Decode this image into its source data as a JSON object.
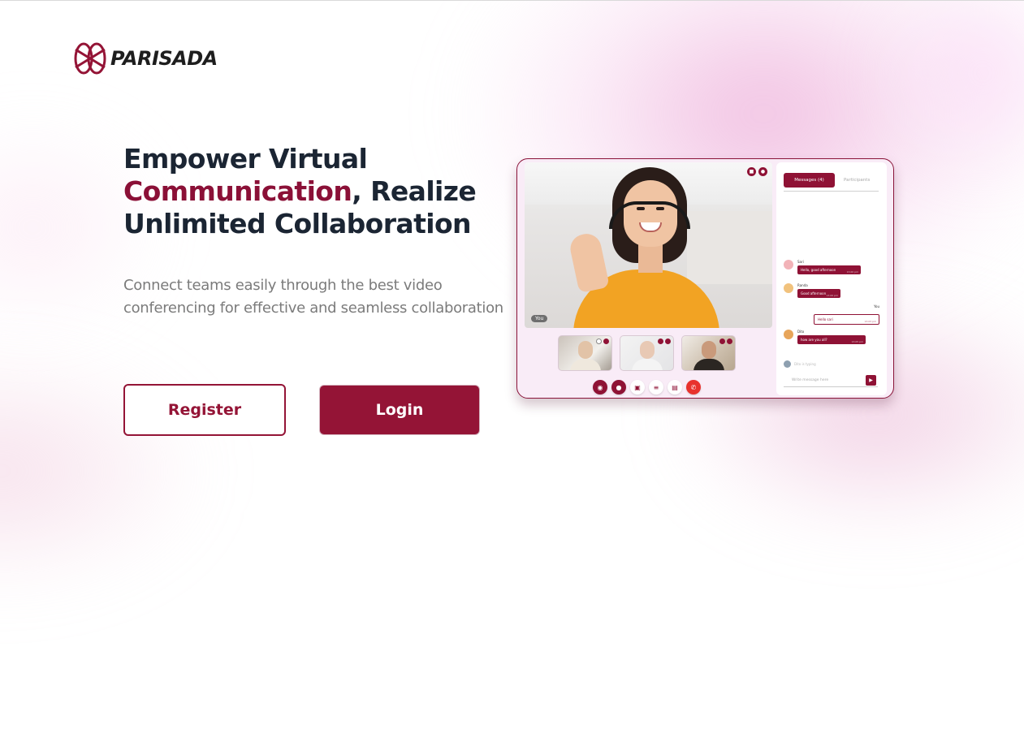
{
  "brand": {
    "name": "PARISADA",
    "color": "#941436"
  },
  "hero": {
    "headline_line1": "Empower Virtual",
    "headline_accent": "Communication",
    "headline_rest": ", Realize",
    "headline_line3": "Unlimited Collaboration",
    "subtext": "Connect teams easily through the best video conferencing for effective and seamless collaboration"
  },
  "buttons": {
    "register": "Register",
    "login": "Login"
  },
  "mockup": {
    "you_label": "You",
    "tabs": {
      "messages": "Messages (4)",
      "participants": "Participants"
    },
    "messages": [
      {
        "name": "Sari",
        "text": "Hello, good afternoon",
        "time": "13.00 pm"
      },
      {
        "name": "Randa",
        "text": "Good afternoon",
        "time": "13.00 pm"
      },
      {
        "name": "You",
        "text": "Hello sari",
        "time": "13.03 pm"
      },
      {
        "name": "Dito",
        "text": "how are you all?",
        "time": "13.05 pm"
      }
    ],
    "typing_text": "Dito is typing",
    "input_placeholder": "Write message here"
  }
}
